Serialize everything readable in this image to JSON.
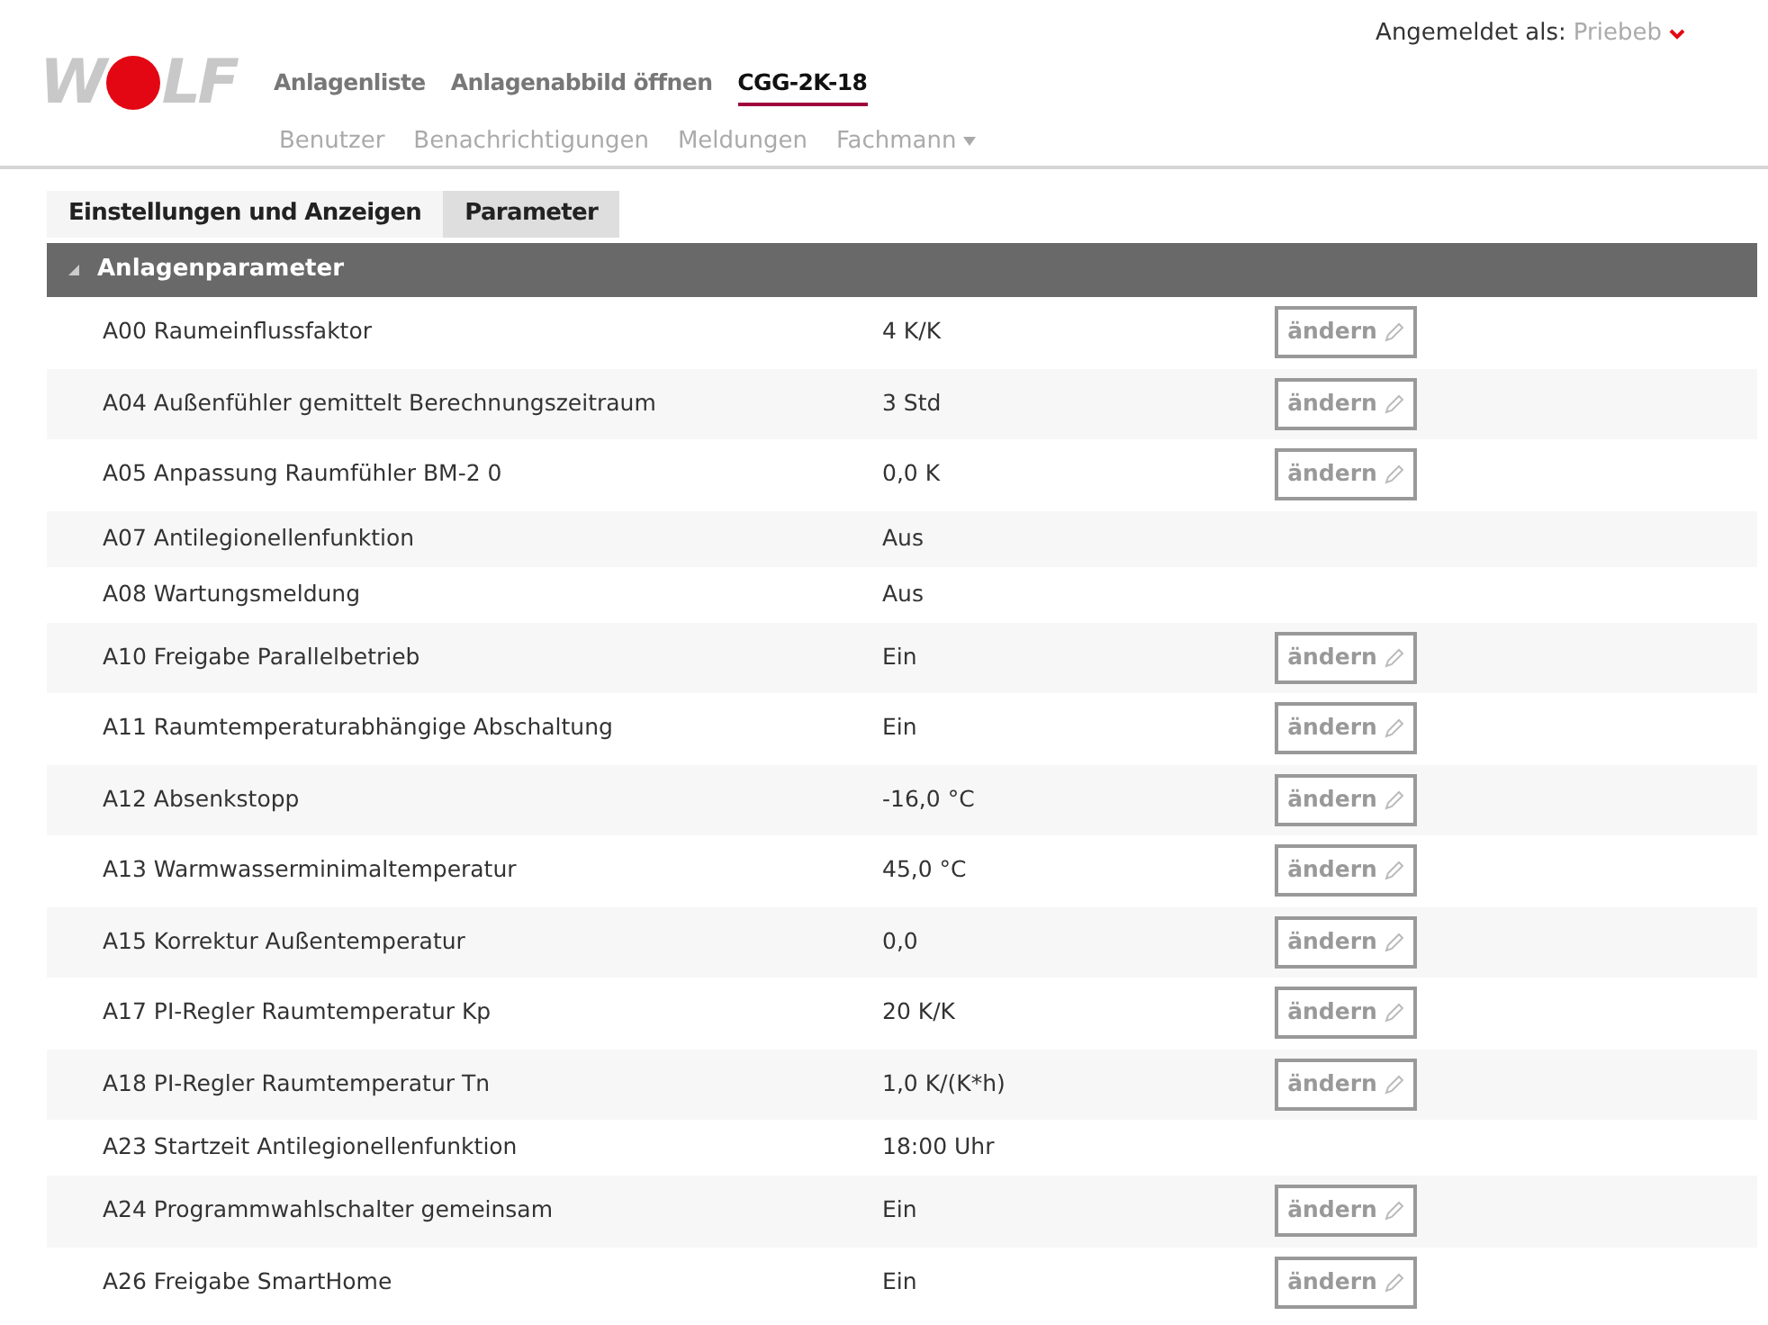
{
  "logo": {
    "left": "W",
    "right": "LF"
  },
  "user": {
    "label": "Angemeldet als:",
    "name": "Priebeb"
  },
  "main_nav": [
    {
      "label": "Anlagenliste",
      "selected": false
    },
    {
      "label": "Anlagenabbild öffnen",
      "selected": false
    },
    {
      "label": "CGG-2K-18",
      "selected": true
    }
  ],
  "sub_nav": [
    {
      "label": "Benutzer",
      "dropdown": false
    },
    {
      "label": "Benachrichtigungen",
      "dropdown": false
    },
    {
      "label": "Meldungen",
      "dropdown": false
    },
    {
      "label": "Fachmann",
      "dropdown": true
    }
  ],
  "tabs": [
    {
      "label": "Einstellungen und Anzeigen",
      "selected": false
    },
    {
      "label": "Parameter",
      "selected": true
    }
  ],
  "section": {
    "title": "Anlagenparameter",
    "expanded": true
  },
  "rows": [
    {
      "name": "A00 Raumeinflussfaktor",
      "value": "4 K/K",
      "button": "ändern"
    },
    {
      "name": "A04 Außenfühler gemittelt Berechnungszeitraum",
      "value": "3 Std",
      "button": "ändern"
    },
    {
      "name": "A05 Anpassung Raumfühler BM-2 0",
      "value": "0,0 K",
      "button": "ändern"
    },
    {
      "name": "A07 Antilegionellenfunktion",
      "value": "Aus"
    },
    {
      "name": "A08 Wartungsmeldung",
      "value": "Aus"
    },
    {
      "name": "A10 Freigabe Parallelbetrieb",
      "value": "Ein",
      "button": "ändern"
    },
    {
      "name": "A11 Raumtemperaturabhängige Abschaltung",
      "value": "Ein",
      "button": "ändern"
    },
    {
      "name": "A12 Absenkstopp",
      "value": "-16,0 °C",
      "button": "ändern"
    },
    {
      "name": "A13 Warmwasserminimaltemperatur",
      "value": "45,0 °C",
      "button": "ändern"
    },
    {
      "name": "A15 Korrektur Außentemperatur",
      "value": "0,0",
      "button": "ändern"
    },
    {
      "name": "A17 PI-Regler Raumtemperatur Kp",
      "value": "20 K/K",
      "button": "ändern"
    },
    {
      "name": "A18 PI-Regler Raumtemperatur Tn",
      "value": "1,0 K/(K*h)",
      "button": "ändern"
    },
    {
      "name": "A23 Startzeit Antilegionellenfunktion",
      "value": "18:00 Uhr"
    },
    {
      "name": "A24 Programmwahlschalter gemeinsam",
      "value": "Ein",
      "button": "ändern"
    },
    {
      "name": "A26 Freigabe SmartHome",
      "value": "Ein",
      "button": "ändern"
    }
  ]
}
